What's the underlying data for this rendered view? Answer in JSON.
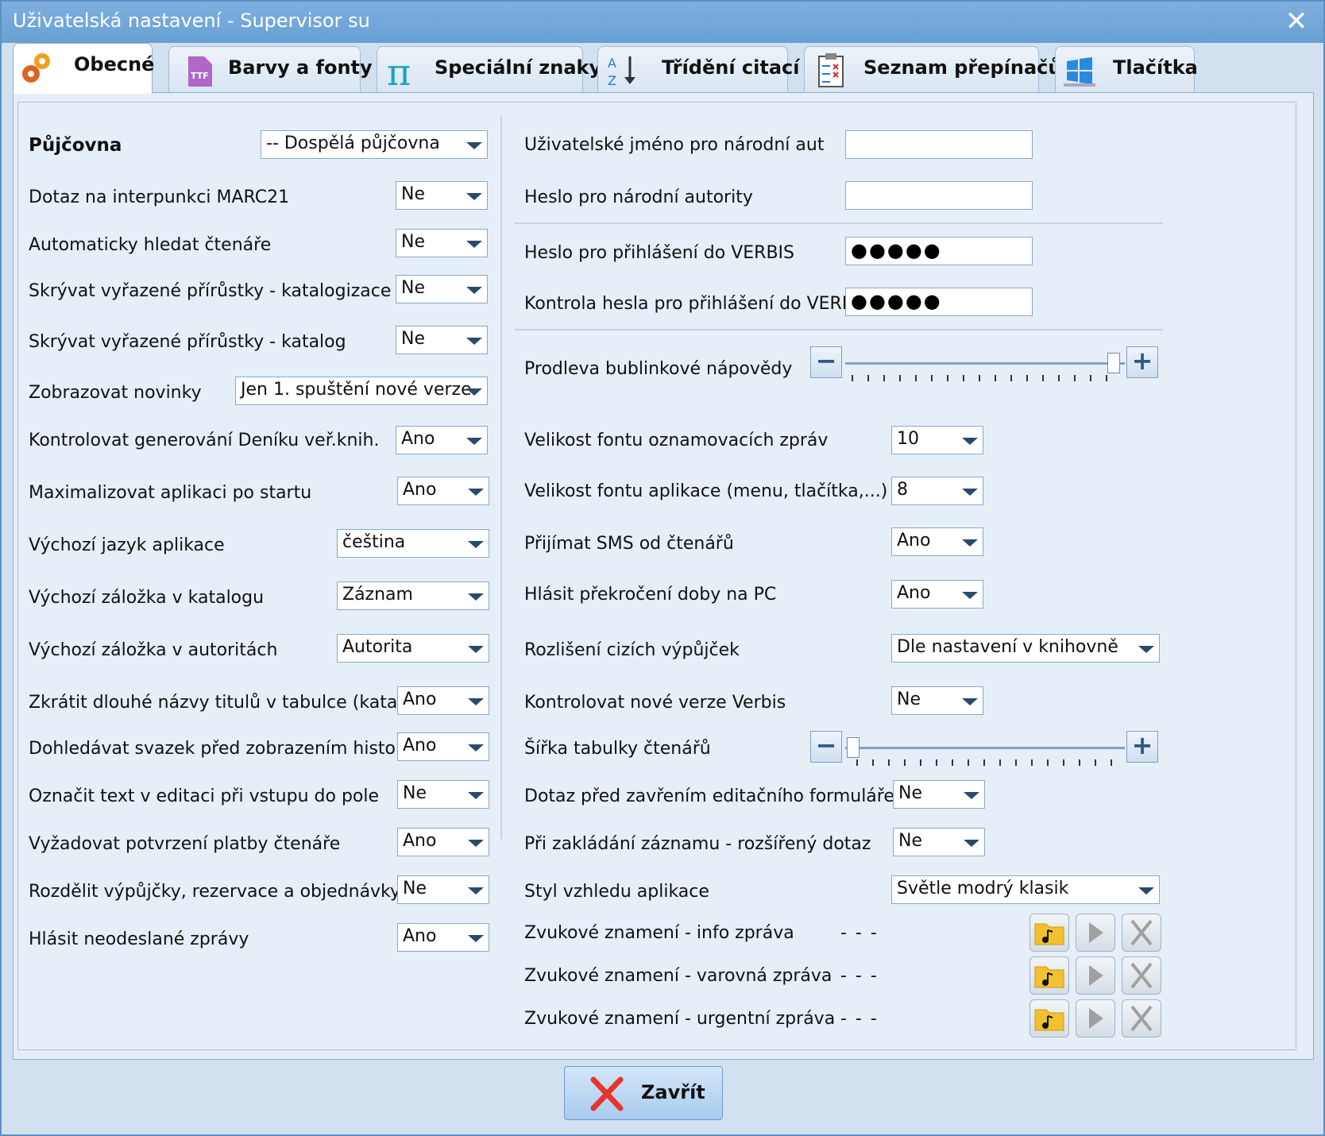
{
  "window": {
    "title": "Uživatelská nastavení - Supervisor su",
    "close_glyph": "✕"
  },
  "tabs": [
    {
      "label": "Obecné",
      "icon": "gears-icon",
      "active": true
    },
    {
      "label": "Barvy a fonty",
      "icon": "ttf-font-icon"
    },
    {
      "label": "Speciální znaky",
      "icon": "pi-icon"
    },
    {
      "label": "Třídění citací",
      "icon": "sort-az-icon"
    },
    {
      "label": "Seznam přepínačů",
      "icon": "checklist-icon"
    },
    {
      "label": "Tlačítka",
      "icon": "windows-icon"
    }
  ],
  "left": {
    "rows": [
      {
        "label": "Půjčovna",
        "value": "-- Dospělá půjčovna",
        "bold": true
      },
      {
        "label": "Dotaz na interpunkci MARC21",
        "value": "Ne"
      },
      {
        "label": "Automaticky hledat čtenáře",
        "value": "Ne"
      },
      {
        "label": "Skrývat vyřazené přírůstky - katalogizace",
        "value": "Ne"
      },
      {
        "label": "Skrývat vyřazené přírůstky - katalog",
        "value": "Ne"
      },
      {
        "label": "Zobrazovat novinky",
        "value": "Jen 1. spuštění nové verze"
      },
      {
        "label": "Kontrolovat generování Deníku veř.knih.",
        "value": "Ano"
      },
      {
        "label": "Maximalizovat aplikaci po startu",
        "value": "Ano"
      },
      {
        "label": "Výchozí jazyk aplikace",
        "value": "čeština"
      },
      {
        "label": "Výchozí záložka v katalogu",
        "value": "Záznam"
      },
      {
        "label": "Výchozí záložka v autoritách",
        "value": "Autorita"
      },
      {
        "label": "Zkrátit dlouhé názvy titulů v tabulce (katalog)",
        "value": "Ano"
      },
      {
        "label": "Dohledávat svazek před zobrazením historie",
        "value": "Ano"
      },
      {
        "label": "Označit text v editaci při vstupu do pole",
        "value": "Ne"
      },
      {
        "label": "Vyžadovat potvrzení platby čtenáře",
        "value": "Ano"
      },
      {
        "label": "Rozdělit výpůjčky, rezervace a objednávky",
        "value": "Ne"
      },
      {
        "label": "Hlásit neodeslané zprávy",
        "value": "Ano"
      }
    ]
  },
  "right": {
    "auth_user_label": "Uživatelské jméno pro národní aut",
    "auth_user_value": "",
    "auth_pass_label": "Heslo pro národní autority",
    "auth_pass_value": "",
    "verbis_pass_label": "Heslo pro přihlášení do VERBIS",
    "verbis_pass_value": "●●●●●",
    "verbis_pass_check_label": "Kontrola hesla pro přihlášení do VERBIS",
    "verbis_pass_check_value": "●●●●●",
    "tooltip_delay_label": "Prodleva bublinkové nápovědy",
    "tooltip_delay_level": 1.0,
    "reader_table_width_label": "Šířka tabulky čtenářů",
    "reader_table_width_level": 0.0,
    "minus": "−",
    "plus": "+",
    "notif_font_label": "Velikost fontu oznamovacích zpráv",
    "notif_font_value": "10",
    "app_font_label": "Velikost fontu aplikace (menu, tlačítka,...)",
    "app_font_value": "8",
    "sms_label": "Přijímat SMS od čtenářů",
    "sms_value": "Ano",
    "pc_time_label": "Hlásit překročení doby na PC",
    "pc_time_value": "Ano",
    "foreign_loans_label": "Rozlišení cizích výpůjček",
    "foreign_loans_value": "Dle nastavení v knihovně",
    "check_versions_label": "Kontrolovat nové verze Verbis",
    "check_versions_value": "Ne",
    "confirm_close_label": "Dotaz před zavřením editačního formuláře",
    "confirm_close_value": "Ne",
    "extended_query_label": "Při zakládání záznamu - rozšířený dotaz",
    "extended_query_value": "Ne",
    "style_label": "Styl vzhledu aplikace",
    "style_value": "Světle modrý klasik",
    "sounds": [
      {
        "label": "Zvukové znamení - info zpráva",
        "value": "- - -"
      },
      {
        "label": "Zvukové znamení - varovná zpráva",
        "value": "- - -"
      },
      {
        "label": "Zvukové znamení - urgentní zpráva",
        "value": "- - -"
      }
    ]
  },
  "footer": {
    "close_label": "Zavřít"
  },
  "colors": {
    "accent": "#6a9fd3",
    "panel": "#e6eef7",
    "close_red": "#e8352a"
  }
}
